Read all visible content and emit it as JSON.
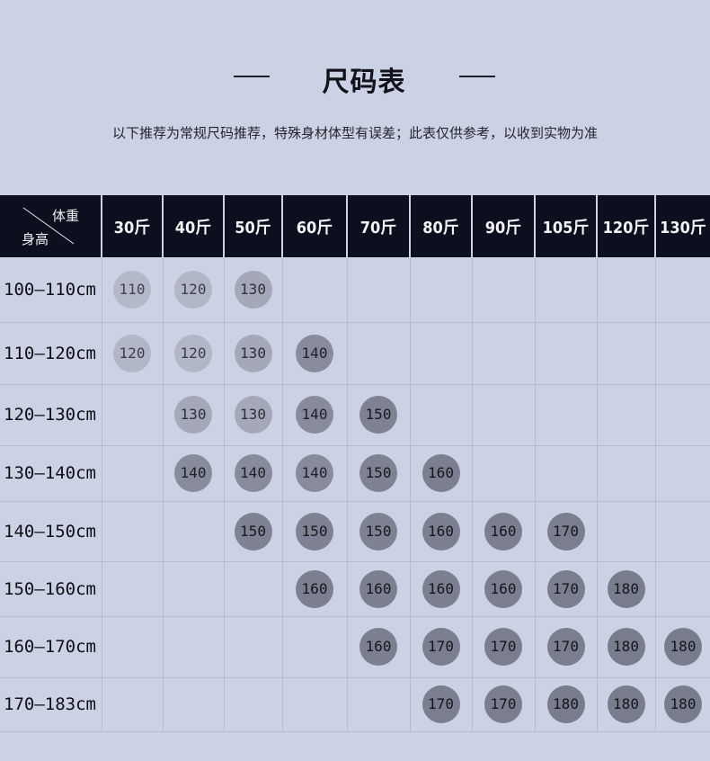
{
  "title": "尺码表",
  "subtitle": "以下推荐为常规尺码推荐，特殊身材体型有误差；此表仅供参考，以收到实物为准",
  "table": {
    "corner_weight": "体重",
    "corner_height": "身高",
    "weights": [
      "30斤",
      "40斤",
      "50斤",
      "60斤",
      "70斤",
      "80斤",
      "90斤",
      "105斤",
      "120斤",
      "130斤"
    ],
    "rows": [
      {
        "height": "100—110cm",
        "cells": [
          "110",
          "120",
          "130",
          "",
          "",
          "",
          "",
          "",
          "",
          ""
        ]
      },
      {
        "height": "110—120cm",
        "cells": [
          "120",
          "120",
          "130",
          "140",
          "",
          "",
          "",
          "",
          "",
          ""
        ]
      },
      {
        "height": "120—130cm",
        "cells": [
          "",
          "130",
          "130",
          "140",
          "150",
          "",
          "",
          "",
          "",
          ""
        ]
      },
      {
        "height": "130—140cm",
        "cells": [
          "",
          "140",
          "140",
          "140",
          "150",
          "160",
          "",
          "",
          "",
          ""
        ]
      },
      {
        "height": "140—150cm",
        "cells": [
          "",
          "",
          "150",
          "150",
          "150",
          "160",
          "160",
          "170",
          "",
          ""
        ]
      },
      {
        "height": "150—160cm",
        "cells": [
          "",
          "",
          "",
          "160",
          "160",
          "160",
          "160",
          "170",
          "180",
          ""
        ]
      },
      {
        "height": "160—170cm",
        "cells": [
          "",
          "",
          "",
          "",
          "160",
          "170",
          "170",
          "170",
          "180",
          "180"
        ]
      },
      {
        "height": "170—183cm",
        "cells": [
          "",
          "",
          "",
          "",
          "",
          "170",
          "170",
          "180",
          "180",
          "180"
        ]
      }
    ]
  },
  "colors": {
    "background": "#ccd2e5",
    "header_bg": "#0b0f1e"
  }
}
